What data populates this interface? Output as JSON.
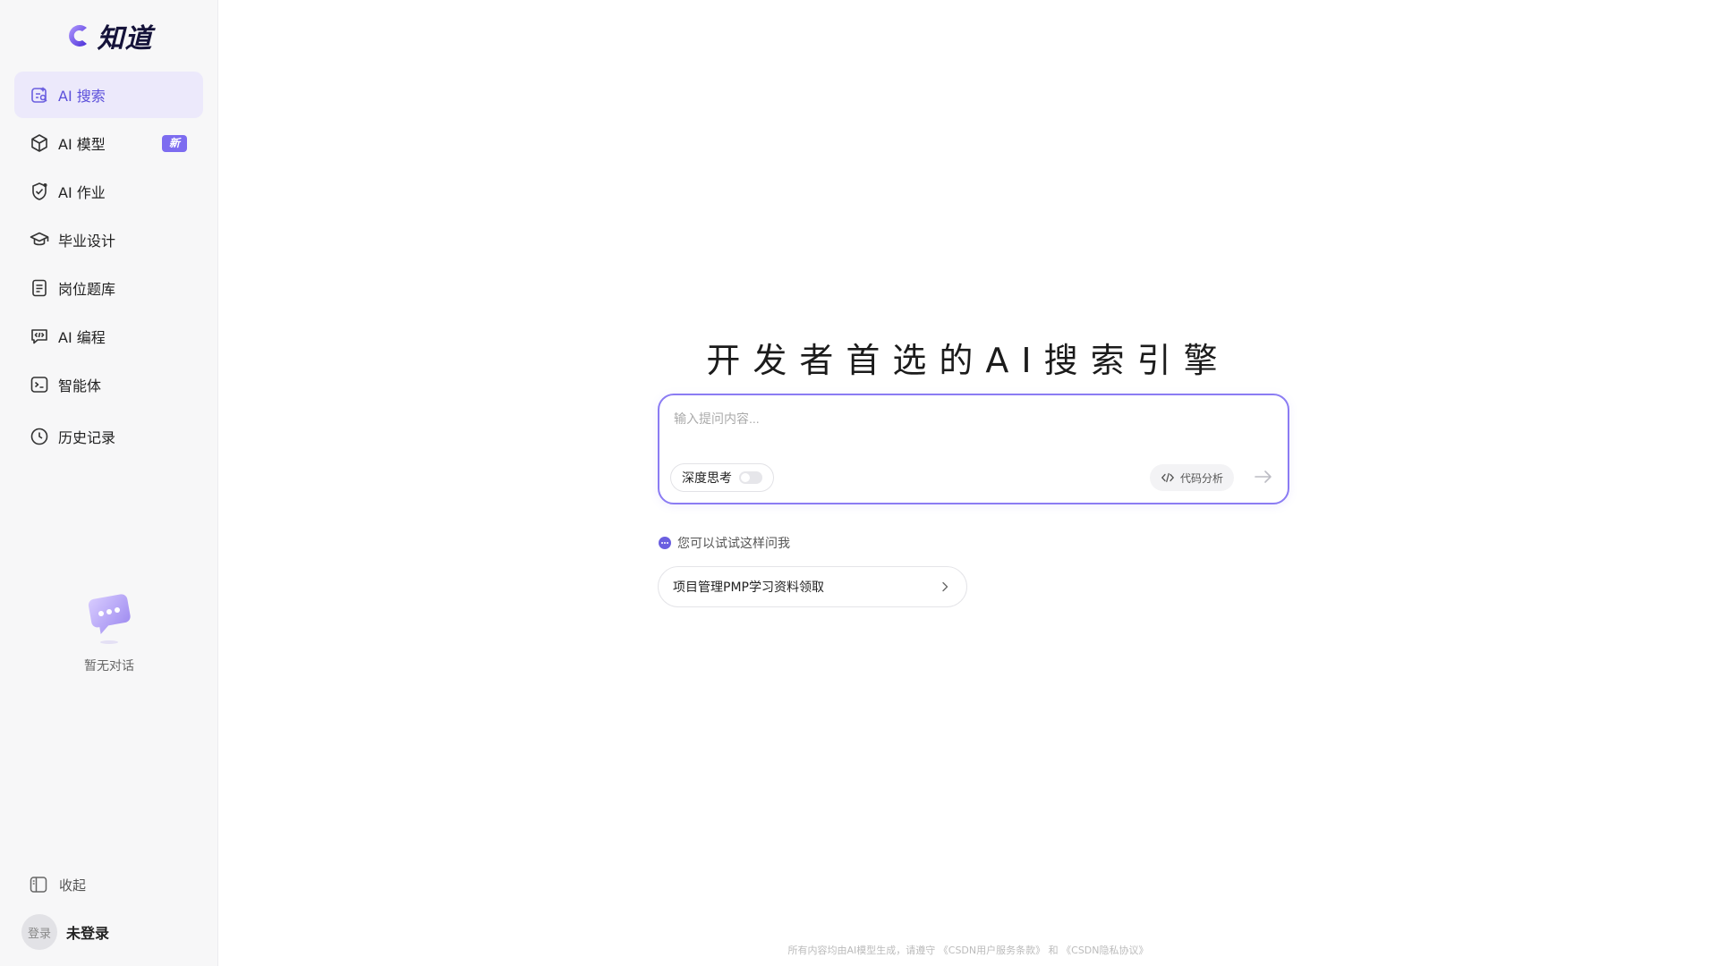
{
  "app": {
    "logo_text": "知道",
    "brand_color": "#5b4fdb"
  },
  "sidebar": {
    "items": [
      {
        "label": "AI 搜索",
        "icon": "ai-search-icon",
        "active": true
      },
      {
        "label": "AI 模型",
        "icon": "cube-icon",
        "badge": "新"
      },
      {
        "label": "AI 作业",
        "icon": "shield-check-icon"
      },
      {
        "label": "毕业设计",
        "icon": "graduation-cap-icon"
      },
      {
        "label": "岗位题库",
        "icon": "document-list-icon"
      },
      {
        "label": "AI 编程",
        "icon": "code-chat-icon"
      },
      {
        "label": "智能体",
        "icon": "terminal-icon"
      },
      {
        "label": "历史记录",
        "icon": "clock-icon"
      }
    ],
    "empty_chat_text": "暂无对话",
    "collapse_label": "收起",
    "user": {
      "avatar_text": "登录",
      "name": "未登录"
    }
  },
  "main": {
    "headline": "开发者首选的AI搜索引擎",
    "composer": {
      "placeholder": "输入提问内容...",
      "deep_think_label": "深度思考",
      "deep_think_enabled": false,
      "code_analysis_label": "代码分析"
    },
    "suggest_label": "您可以试试这样问我",
    "suggestions": [
      "项目管理PMP学习资料领取"
    ],
    "footer": {
      "prefix": "所有内容均由AI模型生成，请遵守",
      "link1": "《CSDN用户服务条款》",
      "and": "和",
      "link2": "《CSDN隐私协议》"
    }
  }
}
